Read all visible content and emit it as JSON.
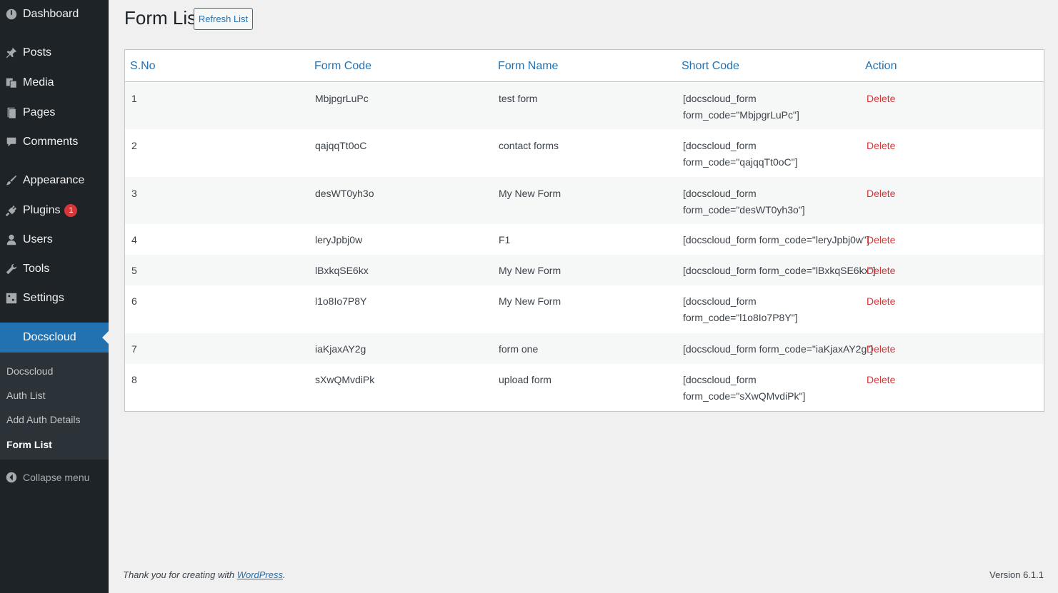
{
  "sidebar": {
    "items": [
      {
        "label": "Dashboard",
        "icon": "dashboard-icon"
      },
      {
        "label": "Posts",
        "icon": "pin-icon"
      },
      {
        "label": "Media",
        "icon": "media-icon"
      },
      {
        "label": "Pages",
        "icon": "page-icon"
      },
      {
        "label": "Comments",
        "icon": "comment-icon"
      },
      {
        "label": "Appearance",
        "icon": "brush-icon"
      },
      {
        "label": "Plugins",
        "icon": "plug-icon",
        "badge": "1"
      },
      {
        "label": "Users",
        "icon": "user-icon"
      },
      {
        "label": "Tools",
        "icon": "wrench-icon"
      },
      {
        "label": "Settings",
        "icon": "settings-icon"
      },
      {
        "label": "Docscloud",
        "active": true
      }
    ],
    "submenu": [
      "Docscloud",
      "Auth List",
      "Add Auth Details",
      "Form List"
    ],
    "current_submenu": "Form List",
    "collapse_label": "Collapse menu"
  },
  "header": {
    "title": "Form List",
    "refresh_label": "Refresh List"
  },
  "table": {
    "columns": [
      "S.No",
      "Form Code",
      "Form Name",
      "Short Code",
      "Action"
    ],
    "rows": [
      {
        "sno": "1",
        "code": "MbjpgrLuPc",
        "name": "test form",
        "short1": "[docscloud_form",
        "short2": "form_code=\"MbjpgrLuPc\"]",
        "action": "Delete"
      },
      {
        "sno": "2",
        "code": "qajqqTt0oC",
        "name": "contact forms",
        "short1": "[docscloud_form",
        "short2": "form_code=\"qajqqTt0oC\"]",
        "action": "Delete"
      },
      {
        "sno": "3",
        "code": "desWT0yh3o",
        "name": "My New Form",
        "short1": "[docscloud_form",
        "short2": "form_code=\"desWT0yh3o\"]",
        "action": "Delete"
      },
      {
        "sno": "4",
        "code": "leryJpbj0w",
        "name": "F1",
        "short1": "[docscloud_form form_code=\"leryJpbj0w\"]",
        "short2": "",
        "action": "Delete"
      },
      {
        "sno": "5",
        "code": "lBxkqSE6kx",
        "name": "My New Form",
        "short1": "[docscloud_form form_code=\"lBxkqSE6kx\"]",
        "short2": "",
        "action": "Delete"
      },
      {
        "sno": "6",
        "code": "l1o8Io7P8Y",
        "name": "My New Form",
        "short1": "[docscloud_form",
        "short2": "form_code=\"l1o8Io7P8Y\"]",
        "action": "Delete"
      },
      {
        "sno": "7",
        "code": "iaKjaxAY2g",
        "name": "form one",
        "short1": "[docscloud_form form_code=\"iaKjaxAY2g\"]",
        "short2": "",
        "action": "Delete"
      },
      {
        "sno": "8",
        "code": "sXwQMvdiPk",
        "name": "upload form",
        "short1": "[docscloud_form",
        "short2": "form_code=\"sXwQMvdiPk\"]",
        "action": "Delete"
      }
    ]
  },
  "footer": {
    "thanks": "Thank you for creating with ",
    "link": "WordPress",
    "period": ".",
    "version": "Version 6.1.1"
  },
  "colors": {
    "sidebar_bg": "#1d2327",
    "accent": "#2271b1",
    "delete": "#d63638"
  }
}
